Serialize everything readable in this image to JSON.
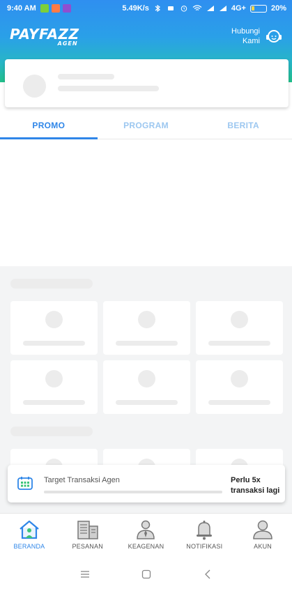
{
  "status_bar": {
    "time": "9:40 AM",
    "network_speed": "5.49K/s",
    "network_type": "4G+",
    "battery": "20%"
  },
  "header": {
    "brand": "PAYFAZZ",
    "brand_sub": "AGEN",
    "contact_line1": "Hubungi",
    "contact_line2": "Kami"
  },
  "tabs": [
    {
      "label": "PROMO",
      "active": true
    },
    {
      "label": "PROGRAM",
      "active": false
    },
    {
      "label": "BERITA",
      "active": false
    }
  ],
  "target": {
    "title": "Target Transaksi Agen",
    "need_line1": "Perlu 5x",
    "need_line2": "transaksi lagi",
    "progress": 0
  },
  "bottom_nav": [
    {
      "label": "BERANDA",
      "icon": "home-icon",
      "active": true
    },
    {
      "label": "PESANAN",
      "icon": "building-icon",
      "active": false
    },
    {
      "label": "KEAGENAN",
      "icon": "agent-icon",
      "active": false
    },
    {
      "label": "NOTIFIKASI",
      "icon": "bell-icon",
      "active": false
    },
    {
      "label": "AKUN",
      "icon": "user-icon",
      "active": false
    }
  ],
  "colors": {
    "accent": "#2f86e8",
    "tab_inactive": "#9cc7f0",
    "header_top": "#2f8ff0",
    "header_bottom": "#22c08a"
  }
}
